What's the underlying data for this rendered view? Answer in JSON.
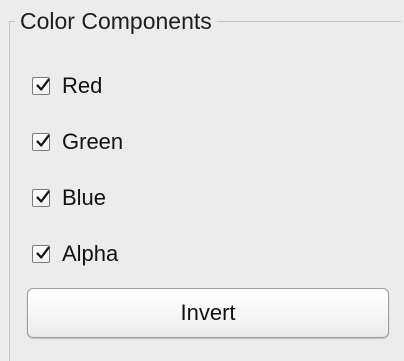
{
  "group": {
    "title": "Color Components"
  },
  "checkboxes": [
    {
      "label": "Red",
      "checked": true
    },
    {
      "label": "Green",
      "checked": true
    },
    {
      "label": "Blue",
      "checked": true
    },
    {
      "label": "Alpha",
      "checked": true
    }
  ],
  "buttons": {
    "invert_label": "Invert"
  },
  "icons": {
    "checkmark": "check-icon"
  }
}
